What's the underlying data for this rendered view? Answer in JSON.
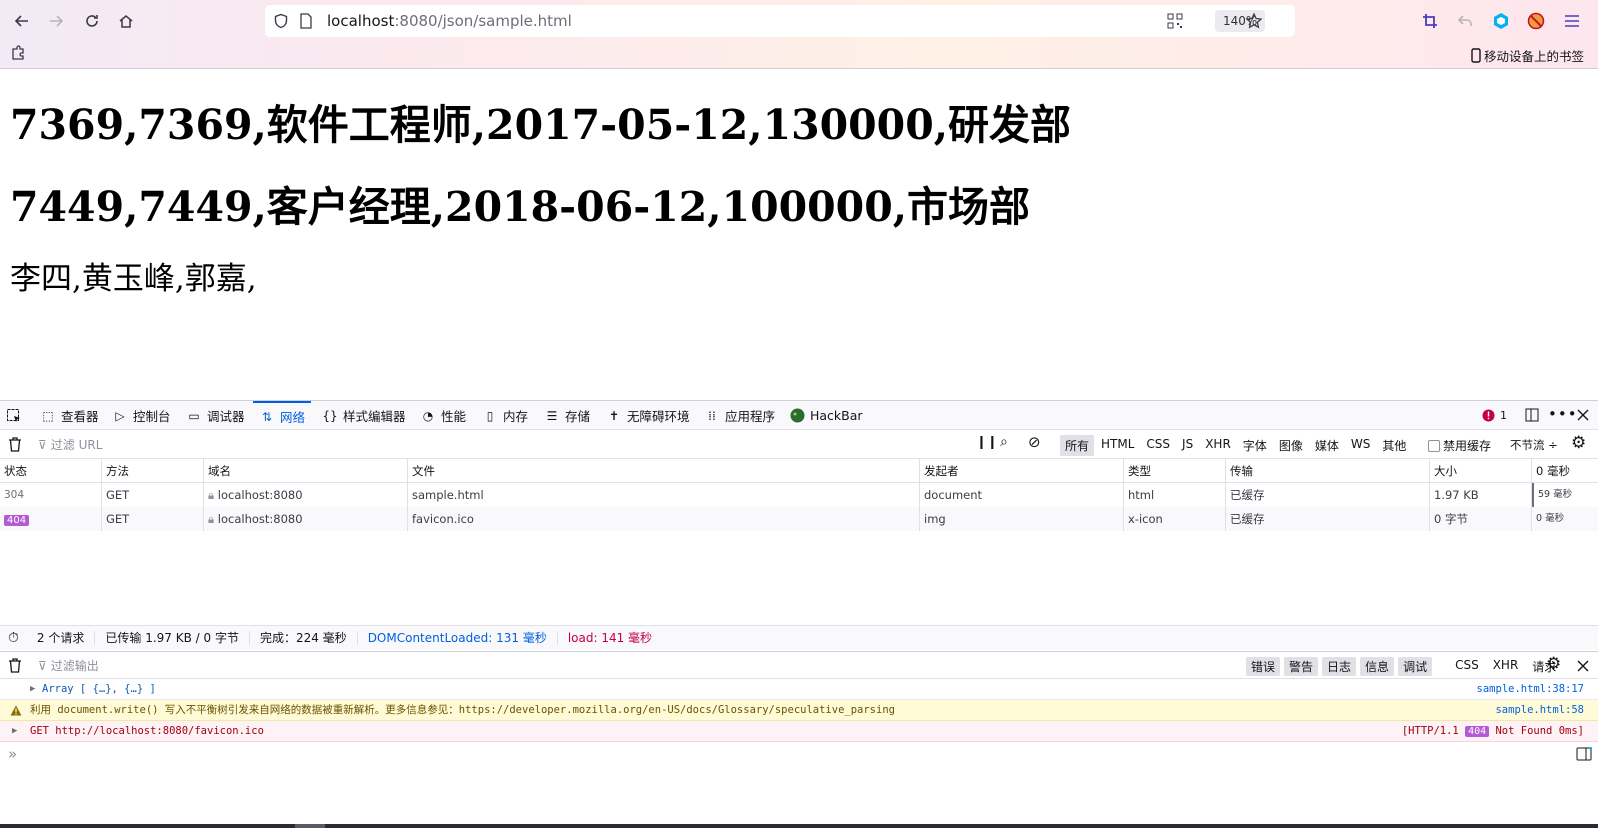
{
  "browser": {
    "url_host": "localhost",
    "url_rest": ":8080/json/sample.html",
    "zoom": "140%",
    "mobile_bookmarks": "移动设备上的书签"
  },
  "page": {
    "line1": "7369,7369,软件工程师,2017-05-12,130000,研发部",
    "line2": "7449,7449,客户经理,2018-06-12,100000,市场部",
    "line3": "李四,黄玉峰,郭嘉,"
  },
  "devtools": {
    "tabs": [
      {
        "label": "查看器"
      },
      {
        "label": "控制台"
      },
      {
        "label": "调试器"
      },
      {
        "label": "网络"
      },
      {
        "label": "样式编辑器"
      },
      {
        "label": "性能"
      },
      {
        "label": "内存"
      },
      {
        "label": "存储"
      },
      {
        "label": "无障碍环境"
      },
      {
        "label": "应用程序"
      },
      {
        "label": "HackBar"
      }
    ],
    "error_count": "1",
    "network": {
      "filter_placeholder": "过滤 URL",
      "type_filters": [
        "所有",
        "HTML",
        "CSS",
        "JS",
        "XHR",
        "字体",
        "图像",
        "媒体",
        "WS",
        "其他"
      ],
      "disable_cache": "禁用缓存",
      "throttle": "不节流 ÷",
      "columns": [
        "状态",
        "方法",
        "域名",
        "文件",
        "发起者",
        "类型",
        "传输",
        "大小",
        "0 毫秒"
      ],
      "rows": [
        {
          "status": "304",
          "method": "GET",
          "domain": "localhost:8080",
          "file": "sample.html",
          "initiator": "document",
          "type": "html",
          "transfer": "已缓存",
          "size": "1.97 KB",
          "time": "59 毫秒"
        },
        {
          "status": "404",
          "method": "GET",
          "domain": "localhost:8080",
          "file": "favicon.ico",
          "initiator": "img",
          "type": "x-icon",
          "transfer": "已缓存",
          "size": "0 字节",
          "time": "0 毫秒"
        }
      ],
      "summary": {
        "requests": "2 个请求",
        "transferred": "已传输 1.97 KB / 0 字节",
        "finish": "完成：224 毫秒",
        "dom_loaded": "DOMContentLoaded: 131 毫秒",
        "load": "load: 141 毫秒"
      }
    },
    "console": {
      "filter_placeholder": "过滤输出",
      "levels": [
        "错误",
        "警告",
        "日志",
        "信息",
        "调试"
      ],
      "extra_filters": [
        "CSS",
        "XHR",
        "请求"
      ],
      "messages": [
        {
          "text": "Array [ {…}, {…} ]",
          "loc": "sample.html:38:17"
        },
        {
          "text": "利用 document.write() 写入不平衡树引发来自网络的数据被重新解析。更多信息参见：https://developer.mozilla.org/en-US/docs/Glossary/speculative_parsing",
          "loc": "sample.html:58"
        },
        {
          "text": "GET http://localhost:8080/favicon.ico",
          "loc_prefix": "[HTTP/1.1",
          "loc_status": "404",
          "loc_suffix": "Not Found 0ms]"
        }
      ],
      "prompt": "»"
    }
  }
}
